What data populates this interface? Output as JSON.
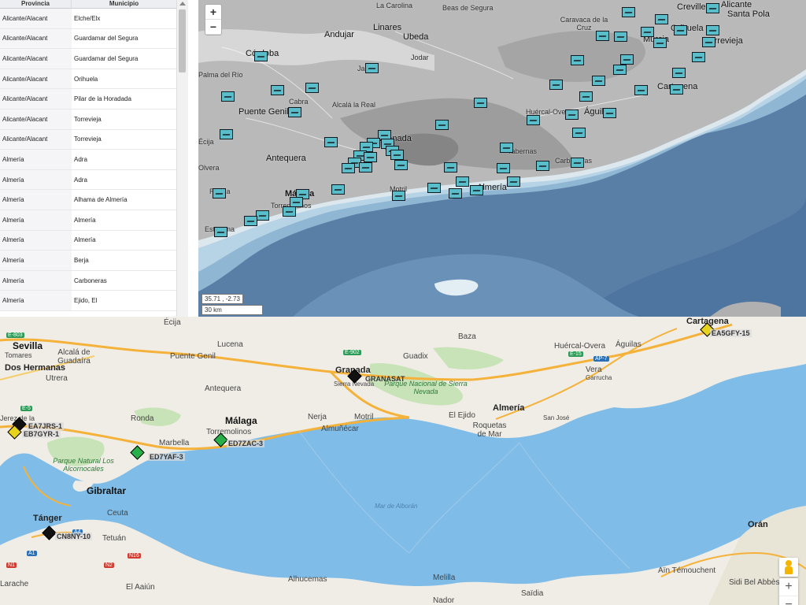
{
  "table": {
    "headers": [
      "Provincia",
      "Municipio"
    ],
    "rows": [
      [
        "Alicante/Alacant",
        "Elche/Elx"
      ],
      [
        "Alicante/Alacant",
        "Guardamar del Segura"
      ],
      [
        "Alicante/Alacant",
        "Guardamar del Segura"
      ],
      [
        "Alicante/Alacant",
        "Orihuela"
      ],
      [
        "Alicante/Alacant",
        "Pilar de la Horadada"
      ],
      [
        "Alicante/Alacant",
        "Torrevieja"
      ],
      [
        "Alicante/Alacant",
        "Torrevieja"
      ],
      [
        "Almería",
        "Adra"
      ],
      [
        "Almería",
        "Adra"
      ],
      [
        "Almería",
        "Alhama de Almería"
      ],
      [
        "Almería",
        "Almería"
      ],
      [
        "Almería",
        "Almería"
      ],
      [
        "Almería",
        "Berja"
      ],
      [
        "Almería",
        "Carboneras"
      ],
      [
        "Almería",
        "Ejido, El"
      ]
    ]
  },
  "map_top": {
    "zoom_in": "+",
    "zoom_out": "−",
    "coordinates": "35.71 , -2.73",
    "scale": "30 km",
    "labels": [
      "La Carolina",
      "Beas de Segura",
      "Caravaca de la Cruz",
      "Crevillente",
      "Alicante",
      "Santa Pola",
      "Andujar",
      "Linares",
      "Ubeda",
      "Jodar",
      "Córdoba",
      "Orihuela",
      "Torrevieja",
      "Murcia",
      "Cartagena",
      "Palma del Río",
      "Cabra",
      "Alcalá la Real",
      "Puente Genil",
      "Jaén",
      "Huércal-Overa",
      "Águilas",
      "Granada",
      "Antequera",
      "Tabernas",
      "Carboneras",
      "Málaga",
      "Torremolinos",
      "Motril",
      "Almería",
      "Estepona",
      "Ronda",
      "Olvera",
      "Écija"
    ],
    "marker_icon": "repeater-marker-icon"
  },
  "map_bottom": {
    "cities": [
      "Sevilla",
      "Alcalá de Guadaíra",
      "Dos Hermanas",
      "Utrera",
      "Tomares",
      "Écija",
      "Lucena",
      "Puente Genil",
      "Antequera",
      "Granada",
      "Sierra Nevada",
      "Guadix",
      "Baza",
      "Huércal-Overa",
      "Águilas",
      "Cartagena",
      "Vera",
      "Garrucha",
      "Almería",
      "Roquetas de Mar",
      "San José",
      "El Ejido",
      "Motril",
      "Almuñécar",
      "Nerja",
      "Málaga",
      "Torremolinos",
      "Marbella",
      "Ronda",
      "Gibraltar",
      "Tánger",
      "Ceuta",
      "Tetuán",
      "Orán",
      "Aïn Témouchent",
      "Sidi Bel Abbès",
      "Melilla",
      "Nador",
      "Alhucemas",
      "Saïdia",
      "El Aaiún",
      "Larache",
      "Jerez de la Frontera"
    ],
    "parks": [
      "Parque Nacional de Sierra Nevada",
      "Parque Natural Los Alcornocales"
    ],
    "sea": "Mar de Alborán",
    "roads": [
      "E-803",
      "E-5",
      "E-902",
      "E-15",
      "AP-7",
      "A4",
      "A1",
      "N16",
      "N2",
      "N1"
    ],
    "callsigns": [
      "ED7YAF-3",
      "EA5GFY-15",
      "EA7JRS-1",
      "EB7GYR-1",
      "ED7YAF-3",
      "ED7ZAC-3",
      "GRANASAT",
      "CN8NY-10"
    ],
    "zoom_in": "+",
    "zoom_out": "−",
    "pegman_icon": "street-view-pegman-icon"
  }
}
